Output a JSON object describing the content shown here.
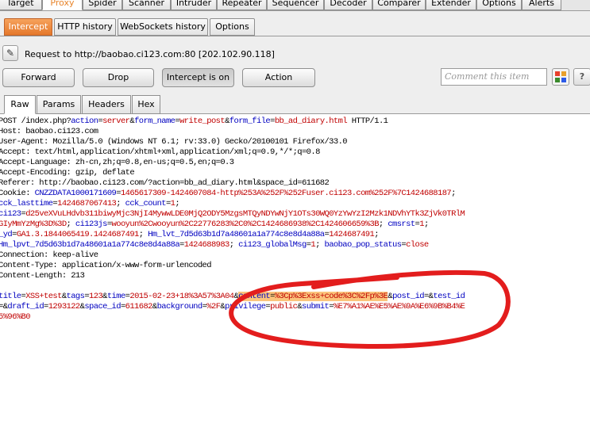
{
  "top_tabs": [
    {
      "label": "Target",
      "active": false
    },
    {
      "label": "Proxy",
      "active": true
    },
    {
      "label": "Spider",
      "active": false
    },
    {
      "label": "Scanner",
      "active": false
    },
    {
      "label": "Intruder",
      "active": false
    },
    {
      "label": "Repeater",
      "active": false
    },
    {
      "label": "Sequencer",
      "active": false
    },
    {
      "label": "Decoder",
      "active": false
    },
    {
      "label": "Comparer",
      "active": false
    },
    {
      "label": "Extender",
      "active": false
    },
    {
      "label": "Options",
      "active": false
    },
    {
      "label": "Alerts",
      "active": false
    }
  ],
  "sub_tabs": [
    {
      "label": "Intercept",
      "active": true
    },
    {
      "label": "HTTP history",
      "active": false
    },
    {
      "label": "WebSockets history",
      "active": false
    },
    {
      "label": "Options",
      "active": false
    }
  ],
  "request_info": "Request to http://baobao.ci123.com:80  [202.102.90.118]",
  "actions": {
    "forward": "Forward",
    "drop": "Drop",
    "intercept": "Intercept is on",
    "action": "Action",
    "comment_placeholder": "Comment this item",
    "help": "?"
  },
  "view_tabs": [
    {
      "label": "Raw",
      "active": true
    },
    {
      "label": "Params",
      "active": false
    },
    {
      "label": "Headers",
      "active": false
    },
    {
      "label": "Hex",
      "active": false
    }
  ],
  "request_lines": [
    [
      [
        "t",
        "POST /index.php?"
      ],
      [
        "k",
        "action"
      ],
      [
        "t",
        "="
      ],
      [
        "v",
        "server"
      ],
      [
        "t",
        "&"
      ],
      [
        "k",
        "form_name"
      ],
      [
        "t",
        "="
      ],
      [
        "v",
        "write_post"
      ],
      [
        "t",
        "&"
      ],
      [
        "k",
        "form_file"
      ],
      [
        "t",
        "="
      ],
      [
        "v",
        "bb_ad_diary.html"
      ],
      [
        "t",
        " HTTP/1.1"
      ]
    ],
    [
      [
        "t",
        "Host: baobao.ci123.com"
      ]
    ],
    [
      [
        "t",
        "User-Agent: Mozilla/5.0 (Windows NT 6.1; rv:33.0) Gecko/20100101 Firefox/33.0"
      ]
    ],
    [
      [
        "t",
        "Accept: text/html,application/xhtml+xml,application/xml;q=0.9,*/*;q=0.8"
      ]
    ],
    [
      [
        "t",
        "Accept-Language: zh-cn,zh;q=0.8,en-us;q=0.5,en;q=0.3"
      ]
    ],
    [
      [
        "t",
        "Accept-Encoding: gzip, deflate"
      ]
    ],
    [
      [
        "t",
        "Referer: http://baobao.ci123.com/?action=bb_ad_diary.html&space_id=611682"
      ]
    ],
    [
      [
        "t",
        "Cookie: "
      ],
      [
        "k",
        "CNZZDATA1000171609"
      ],
      [
        "t",
        "="
      ],
      [
        "v",
        "1465617309-1424607084-http%253A%252F%252Fuser.ci123.com%252F%7C1424688187"
      ],
      [
        "t",
        ";"
      ]
    ],
    [
      [
        "k",
        "cck_lasttime"
      ],
      [
        "t",
        "="
      ],
      [
        "v",
        "1424687067413"
      ],
      [
        "t",
        "; "
      ],
      [
        "k",
        "cck_count"
      ],
      [
        "t",
        "="
      ],
      [
        "v",
        "1"
      ],
      [
        "t",
        ";"
      ]
    ],
    [
      [
        "k",
        "ci123"
      ],
      [
        "t",
        "="
      ],
      [
        "v",
        "d25veXVuLHdvb311biwyMjc3NjI4MywwLDE0MjQ2ODY5MzgsMTQyNDYwNjY1OTs30WQ0YzYwYzI2Mzk1NDVhYTk3ZjVk0TRlM"
      ]
    ],
    [
      [
        "v",
        "GIyMmYzMg%3D%3D"
      ],
      [
        "t",
        "; "
      ],
      [
        "k",
        "ci123js"
      ],
      [
        "t",
        "="
      ],
      [
        "v",
        "wooyun%2Cwooyun%2C22776283%2C0%2C1424686938%2C1424606659%3B"
      ],
      [
        "t",
        "; "
      ],
      [
        "k",
        "cmsrst"
      ],
      [
        "t",
        "="
      ],
      [
        "v",
        "1"
      ],
      [
        "t",
        ";"
      ]
    ],
    [
      [
        "k",
        "_yd"
      ],
      [
        "t",
        "="
      ],
      [
        "v",
        "GA1.3.1844065419.1424687491"
      ],
      [
        "t",
        "; "
      ],
      [
        "k",
        "Hm_lvt_7d5d63b1d7a48601a1a774c8e8d4a88a"
      ],
      [
        "t",
        "="
      ],
      [
        "v",
        "1424687491"
      ],
      [
        "t",
        ";"
      ]
    ],
    [
      [
        "k",
        "Hm_lpvt_7d5d63b1d7a48601a1a774c8e8d4a88a"
      ],
      [
        "t",
        "="
      ],
      [
        "v",
        "1424688983"
      ],
      [
        "t",
        "; "
      ],
      [
        "k",
        "ci123_globalMsg"
      ],
      [
        "t",
        "="
      ],
      [
        "v",
        "1"
      ],
      [
        "t",
        "; "
      ],
      [
        "k",
        "baobao_pop_status"
      ],
      [
        "t",
        "="
      ],
      [
        "v",
        "close"
      ]
    ],
    [
      [
        "t",
        "Connection: keep-alive"
      ]
    ],
    [
      [
        "t",
        "Content-Type: application/x-www-form-urlencoded"
      ]
    ],
    [
      [
        "t",
        "Content-Length: 213"
      ]
    ],
    [
      [
        "t",
        ""
      ]
    ],
    [
      [
        "k",
        "title"
      ],
      [
        "t",
        "="
      ],
      [
        "v",
        "XSS+test"
      ],
      [
        "t",
        "&"
      ],
      [
        "k",
        "tags"
      ],
      [
        "t",
        "="
      ],
      [
        "v",
        "123"
      ],
      [
        "t",
        "&"
      ],
      [
        "k",
        "time"
      ],
      [
        "t",
        "="
      ],
      [
        "v",
        "2015-02-23+18%3A57%3A04"
      ],
      [
        "t",
        "&"
      ],
      [
        "kh",
        "content"
      ],
      [
        "th",
        "="
      ],
      [
        "vh",
        "%3Cp%3Exss+code%3C%2Fp%3E"
      ],
      [
        "t",
        "&"
      ],
      [
        "k",
        "post_id"
      ],
      [
        "t",
        "=&"
      ],
      [
        "k",
        "test_id"
      ]
    ],
    [
      [
        "t",
        "=&"
      ],
      [
        "k",
        "draft_id"
      ],
      [
        "t",
        "="
      ],
      [
        "v",
        "1293122"
      ],
      [
        "t",
        "&"
      ],
      [
        "k",
        "space_id"
      ],
      [
        "t",
        "="
      ],
      [
        "v",
        "611682"
      ],
      [
        "t",
        "&"
      ],
      [
        "k",
        "background"
      ],
      [
        "t",
        "="
      ],
      [
        "v",
        "%2F"
      ],
      [
        "t",
        "&"
      ],
      [
        "k",
        "privilege"
      ],
      [
        "t",
        "="
      ],
      [
        "v",
        "public"
      ],
      [
        "t",
        "&"
      ],
      [
        "k",
        "submit"
      ],
      [
        "t",
        "="
      ],
      [
        "v",
        "%E7%A1%AE%E5%AE%9A%E6%9B%B4%E"
      ]
    ],
    [
      [
        "v",
        "5%96%B0"
      ]
    ]
  ]
}
